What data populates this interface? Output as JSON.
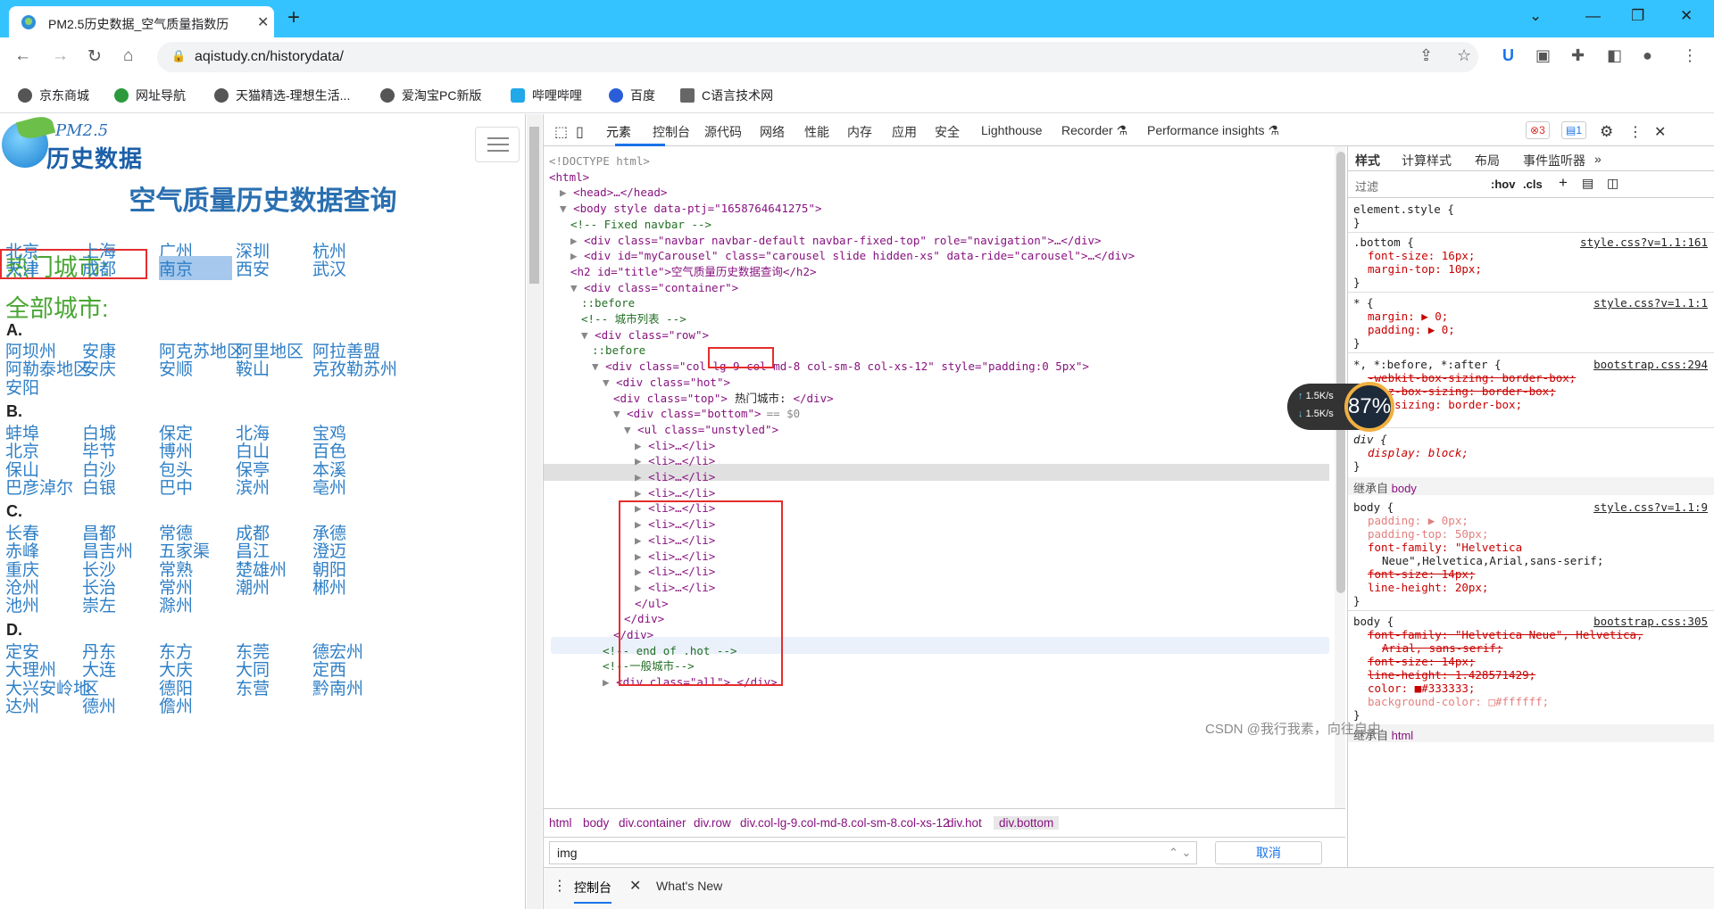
{
  "browser": {
    "tab_title": "PM2.5历史数据_空气质量指数历",
    "url": "aqistudy.cn/historydata/",
    "bookmarks": [
      "京东商城",
      "网址导航",
      "天猫精选-理想生活...",
      "爱淘宝PC新版",
      "哔哩哔哩",
      "百度",
      "C语言技术网"
    ]
  },
  "site": {
    "logo_pm": "PM2.5",
    "logo_text": "历史数据",
    "title": "空气质量历史数据查询",
    "hot_title": "热门城市:",
    "hot_cities": [
      "北京",
      "上海",
      "广州",
      "深圳",
      "杭州",
      "天津",
      "成都",
      "南京",
      "西安",
      "武汉"
    ],
    "all_title": "全部城市:",
    "letters": [
      "A.",
      "B.",
      "C.",
      "D."
    ],
    "groups": {
      "A": [
        "阿坝州",
        "安康",
        "阿克苏地区",
        "阿里地区",
        "阿拉善盟",
        "阿勒泰地区",
        "安庆",
        "安顺",
        "鞍山",
        "克孜勒苏州",
        "安阳"
      ],
      "B": [
        "蚌埠",
        "白城",
        "保定",
        "北海",
        "宝鸡",
        "北京",
        "毕节",
        "博州",
        "白山",
        "百色",
        "保山",
        "白沙",
        "包头",
        "保亭",
        "本溪",
        "巴彦淖尔",
        "白银",
        "巴中",
        "滨州",
        "亳州"
      ],
      "C": [
        "长春",
        "昌都",
        "常德",
        "成都",
        "承德",
        "赤峰",
        "昌吉州",
        "五家渠",
        "昌江",
        "澄迈",
        "重庆",
        "长沙",
        "常熟",
        "楚雄州",
        "朝阳",
        "沧州",
        "长治",
        "常州",
        "潮州",
        "郴州",
        "池州",
        "崇左",
        "滁州"
      ],
      "D": [
        "定安",
        "丹东",
        "东方",
        "东莞",
        "德宏州",
        "大理州",
        "大连",
        "大庆",
        "大同",
        "定西",
        "大兴安岭地",
        "区",
        "德阳",
        "东营",
        "黔南州",
        "达州",
        "德州",
        "儋州"
      ]
    }
  },
  "devtools": {
    "tabs": [
      "元素",
      "控制台",
      "源代码",
      "网络",
      "性能",
      "内存",
      "应用",
      "安全",
      "Lighthouse",
      "Recorder ⚗",
      "Performance insights ⚗"
    ],
    "errors": "3",
    "messages": "1",
    "dom_lines": [
      "<!DOCTYPE html>",
      "<html>",
      "<head>…</head>",
      "<body style data-ptj=\"1658764641275\">",
      "<!-- Fixed navbar -->",
      "<div class=\"navbar navbar-default navbar-fixed-top\" role=\"navigation\">…</div>",
      "<div id=\"myCarousel\" class=\"carousel slide hidden-xs\" data-ride=\"carousel\">…</div>",
      "<h2 id=\"title\">空气质量历史数据查询</h2>",
      "<div class=\"container\">",
      "::before",
      "<!-- 城市列表 -->",
      "<div class=\"row\">",
      "::before",
      "<div class=\"col-lg-9 col-md-8 col-sm-8 col-xs-12\" style=\"padding:0 5px\">",
      "<div class=\"hot\">",
      "<div class=\"top\">",
      "热门城市:",
      "</div>",
      "<div class=\"bottom\">",
      "== $0",
      "<ul class=\"unstyled\">",
      "<li>…</li>",
      "</ul>",
      "</div>",
      "</div>",
      "<!-- end of .hot -->",
      "<!--一般城市-->",
      "<div class=\"all\">…</div>"
    ],
    "breadcrumbs": [
      "html",
      "body",
      "div.container",
      "div.row",
      "div.col-lg-9.col-md-8.col-sm-8.col-xs-12",
      "div.hot",
      "div.bottom"
    ],
    "search_value": "img",
    "cancel_label": "取消",
    "drawer_tabs": [
      "控制台",
      "What's New"
    ],
    "styles_tabs": [
      "样式",
      "计算样式",
      "布局",
      "事件监听器",
      "»"
    ],
    "filter_placeholder": "过滤",
    "filter_hov": ":hov",
    "filter_cls": ".cls",
    "rules": {
      "element_style": "element.style {",
      "bottom_selector": ".bottom {",
      "bottom_src": "style.css?v=1.1:161",
      "bottom_font_size": "font-size: 16px;",
      "bottom_margin_top": "margin-top: 10px;",
      "star_selector": "* {",
      "star_src": "style.css?v=1.1:1",
      "star_margin": "margin: ▶ 0;",
      "star_padding": "padding: ▶ 0;",
      "bs_selector": "*, *:before, *:after {",
      "bs_src": "bootstrap.css:294",
      "bs_webkit": "-webkit-box-sizing: border-box;",
      "bs_moz": "-moz-box-sizing: border-box;",
      "bs_box": "box-sizing: border-box;",
      "div_selector": "div {",
      "div_display": "display: block;",
      "inherited_label": "继承自",
      "inherited_body": "body",
      "inherited_html": "html",
      "body1_src": "style.css?v=1.1:9",
      "body1_padding": "padding: ▶ 0px;",
      "body1_padding_top": "padding-top: 50px;",
      "body1_font_family": "font-family: \"Helvetica",
      "body1_font_family2": "Neue\",Helvetica,Arial,sans-serif;",
      "body1_font_size": "font-size: 14px;",
      "body1_line_height": "line-height: 20px;",
      "body2_src": "bootstrap.css:305",
      "body2_font_family": "font-family: \"Helvetica Neue\", Helvetica,",
      "body2_font_family2": "Arial, sans-serif;",
      "body2_font_size": "font-size: 14px;",
      "body2_line_height": "line-height: 1.428571429;",
      "body2_color": "color: ■#333333;",
      "body2_bg": "background-color: □#ffffff;",
      "brace_close": "}",
      "body_selector": "body {"
    },
    "net_up": "1.5K/s",
    "net_down": "1.5K/s",
    "cpu": "87%"
  },
  "watermark": "CSDN @我行我素，向往自由",
  "colors": {
    "tabbar": "#35c3ff",
    "link": "#2f7fc6",
    "green_heading": "#4aa634",
    "highlight_box": "#e52d2d"
  }
}
